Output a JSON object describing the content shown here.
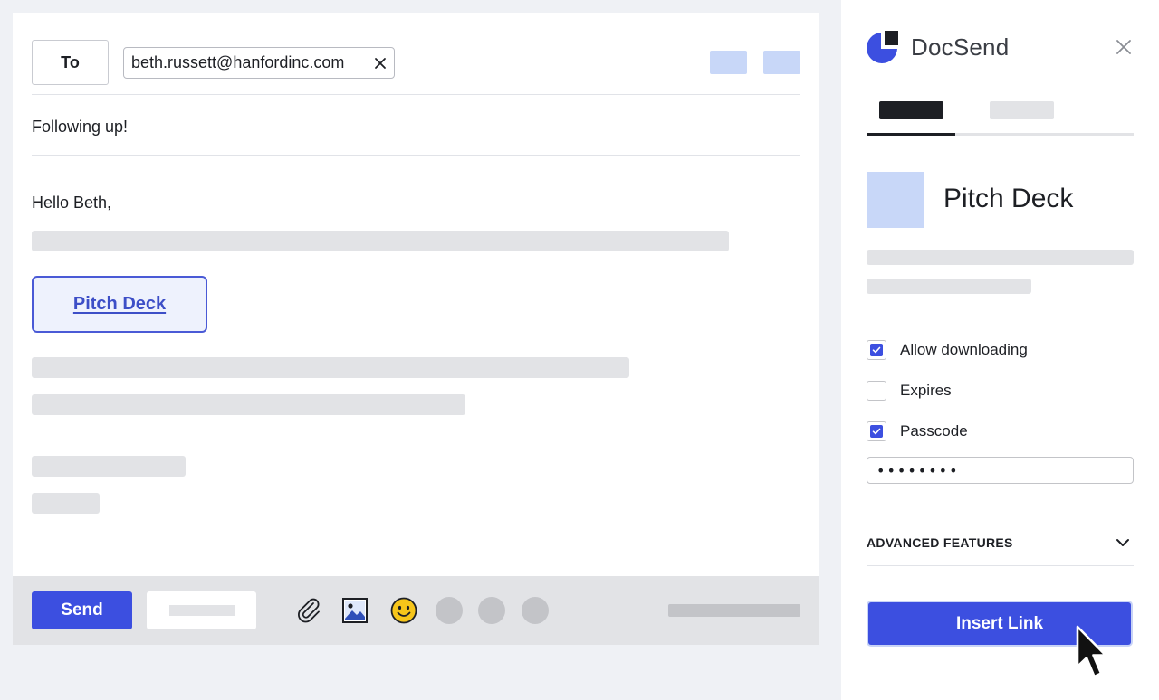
{
  "compose": {
    "to_label": "To",
    "recipient": "beth.russett@hanfordinc.com",
    "subject": "Following up!",
    "greeting": "Hello Beth,",
    "doc_link": "Pitch Deck",
    "send_label": "Send"
  },
  "panel": {
    "brand": "DocSend",
    "doc_title": "Pitch Deck",
    "options": [
      {
        "label": "Allow downloading",
        "checked": true
      },
      {
        "label": "Expires",
        "checked": false
      },
      {
        "label": "Passcode",
        "checked": true
      }
    ],
    "passcode_value": "••••••••",
    "advanced_label": "ADVANCED FEATURES",
    "insert_label": "Insert Link"
  },
  "colors": {
    "accent": "#3c4fe0",
    "placeholder_blue": "#c8d7f8",
    "placeholder_gray": "#e2e3e6"
  },
  "icons": [
    "close-icon",
    "paperclip-icon",
    "image-icon",
    "emoji-icon",
    "docsend-logo-icon",
    "chevron-down-icon",
    "cursor-icon"
  ]
}
